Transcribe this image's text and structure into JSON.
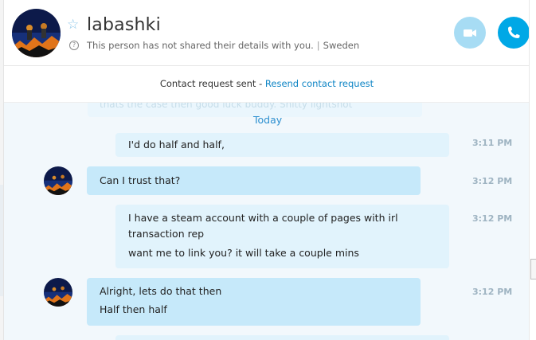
{
  "header": {
    "contact_name": "labashki",
    "details_notice": "This person has not shared their details with you.",
    "location": "Sweden",
    "info_glyph": "?"
  },
  "contact_request": {
    "sent_text": "Contact request sent - ",
    "resend_label": "Resend contact request"
  },
  "chat": {
    "faded_text": "thats the case then good luck buddy. Shitty lightshot",
    "day_divider": "Today",
    "messages": [
      {
        "direction": "outgoing",
        "lines": [
          "I'd do half and half,"
        ],
        "time": "3:11 PM"
      },
      {
        "direction": "incoming",
        "lines": [
          "Can I trust that?"
        ],
        "time": "3:12 PM"
      },
      {
        "direction": "outgoing",
        "lines": [
          "I have a steam account with a couple of pages with irl",
          "transaction rep",
          "want me to link you? it will take a couple mins"
        ],
        "time": "3:12 PM"
      },
      {
        "direction": "incoming",
        "lines": [
          "Alright, lets do that then",
          "Half then half"
        ],
        "time": "3:12 PM"
      }
    ]
  },
  "colors": {
    "accent": "#00a8e6",
    "video_button": "#a7dcf4",
    "incoming_bubble": "#c6e9fa",
    "outgoing_bubble": "#e1f3fc",
    "link": "#0f85c5"
  },
  "icons": [
    "star-icon",
    "info-icon",
    "video-call-icon",
    "phone-icon"
  ]
}
